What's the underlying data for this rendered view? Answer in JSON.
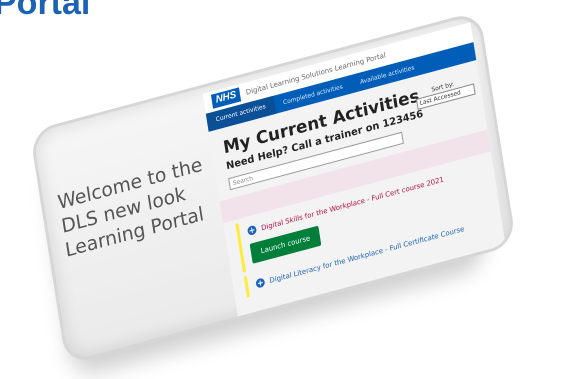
{
  "heading": "Portal",
  "welcome": "Welcome to the DLS new look Learning Portal",
  "app": {
    "logo": "NHS",
    "subtitle": "Digital Learning Solutions Learning Portal",
    "nav": [
      "Current activities",
      "Completed activities",
      "Available activities"
    ],
    "page_title": "My Current Activities",
    "help_text": "Need Help? Call a trainer on 123456",
    "sort_label": "Sort by:",
    "sort_value": "Last Accessed",
    "search_placeholder": "Search",
    "courses": [
      {
        "title": "Digital Skills for the Workplace - Full Cert course 2021",
        "action": "Launch course"
      },
      {
        "title": "Digital Literacy for the Workplace - Full Certificate Course"
      }
    ]
  },
  "colors": {
    "nhs_blue": "#005eb8",
    "heading_blue": "#1c63b8",
    "launch_green": "#007f3b",
    "highlight_yellow": "#ffeb3b"
  }
}
